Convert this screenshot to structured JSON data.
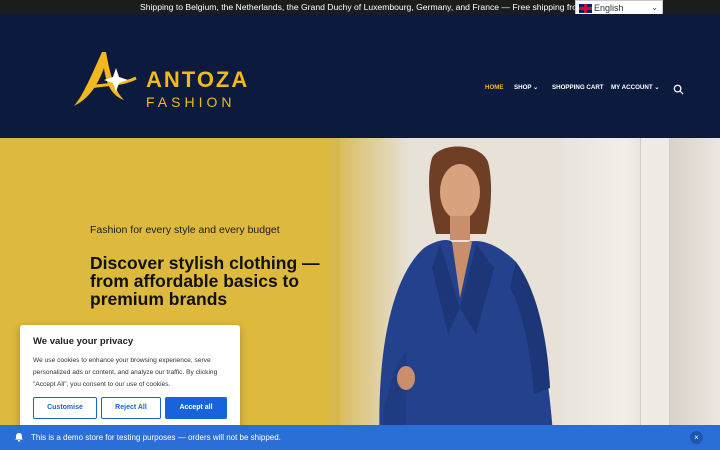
{
  "announcement": {
    "text": "Shipping to Belgium, the Netherlands, the Grand Duchy of Luxembourg, Germany, and France — Free shipping from €50.00"
  },
  "language_selector": {
    "selected": "English",
    "icon": "uk-flag-icon"
  },
  "header": {
    "logo_line1": "ANTOZA",
    "logo_line2": "FASHION",
    "brand_color": "#f3b81e",
    "background": "#0c1a3d",
    "nav": [
      {
        "label": "HOME",
        "active": true
      },
      {
        "label": "SHOP",
        "dropdown": true
      },
      {
        "label": "SHOPPING CART"
      },
      {
        "label": "MY ACCOUNT",
        "dropdown": true
      }
    ],
    "search_icon": "search-icon"
  },
  "hero": {
    "subtitle": "Fashion for every style and every budget",
    "title": "Discover stylish clothing — from affordable basics to premium brands",
    "accent_color": "#ddb93e"
  },
  "cookie_dialog": {
    "title": "We value your privacy",
    "body": "We use cookies to enhance your browsing experience, serve personalized ads or content, and analyze our traffic. By clicking \"Accept All\", you consent to our use of cookies.",
    "customise": "Customise",
    "reject": "Reject All",
    "accept": "Accept all",
    "button_color": "#1863dc"
  },
  "demo_notice": {
    "text": "This is a demo store for testing purposes — orders will not be shipped.",
    "close": "×",
    "color": "#2b6fd6"
  }
}
